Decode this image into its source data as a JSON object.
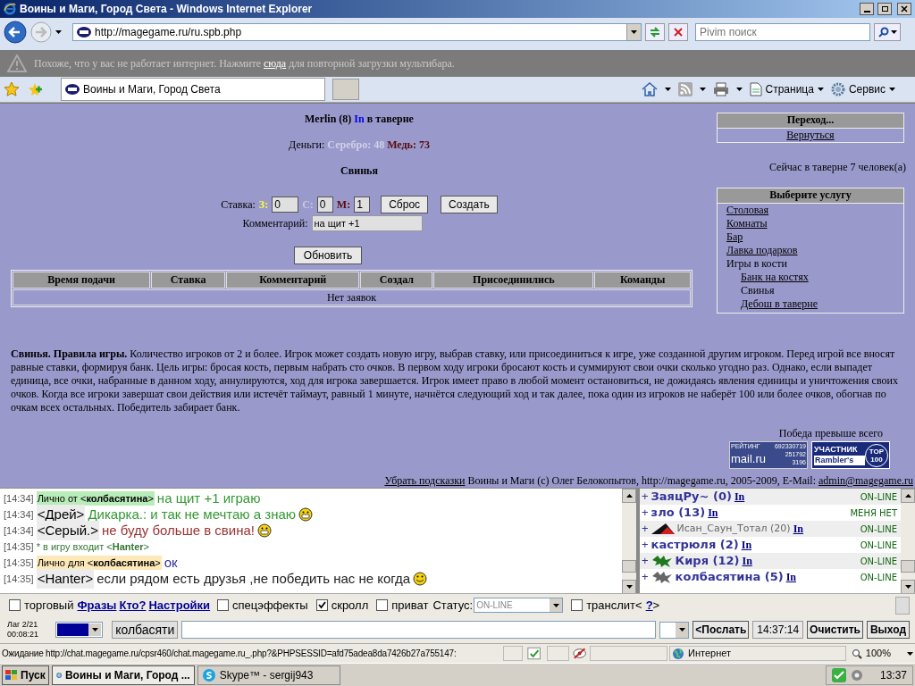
{
  "window": {
    "title": "Воины и Маги, Город Света - Windows Internet Explorer"
  },
  "address_bar": {
    "url": "http://magegame.ru/ru.spb.php",
    "search_placeholder": "Pivim поиск"
  },
  "infobar": {
    "before": "Похоже, что у вас не работает интернет. Нажмите",
    "link": "сюда",
    "after": "для повторной загрузки мультибара."
  },
  "tabs": [
    {
      "label": "Воины и Маги, Город Света",
      "selected": true
    }
  ],
  "command_bar": [
    "Страница",
    "Сервис"
  ],
  "game": {
    "player": "Merlin (8)",
    "player_link": "In",
    "location": "в таверне",
    "money": {
      "label": "Деньги:",
      "silver": "Серебро: 48",
      "copper": "Медь: 73"
    },
    "title": "Свинья",
    "bet": {
      "label": "Ставка:",
      "gold_label": "З:",
      "gold": "0",
      "silver_label": "С:",
      "silver": "0",
      "copper_label": "М:",
      "copper": "1"
    },
    "reset_button": "Сброс",
    "create_button": "Создать",
    "comment_label": "Комментарий:",
    "comment": "на щит +1",
    "refresh_button": "Обновить",
    "table": {
      "columns": [
        "Время подачи",
        "Ставка",
        "Комментарий",
        "Создал",
        "Присоединились",
        "Команды"
      ],
      "empty": "Нет заявок"
    },
    "rules": "**Свинья. Правила игры.** Количество игроков от 2 и более. Игрок может создать новую игру, выбрав ставку, или присоединиться к игре, уже созданной другим игроком. Перед игрой все вносят равные ставки, формируя банк. Цель игры: бросая кость, первым набрать сто очков. В первом ходу игроки бросают кость и суммируют свои очки сколько угодно раз. Однако, если выпадет единица, все очки, набранные в данном ходу, аннулируются, ход для игрока завершается. Игрок имеет право в любой момент остановиться, не дожидаясь явления единицы и уничтожения своих очков. Когда все игроки завершат свои действия или истечёт таймаут, равный 1 минуте, начнётся следующий ход и так далее, пока один из игроков не наберёт 100 или более очков, обогнав по очкам всех остальных. Победитель забирает банк.",
    "motto": "Победа превыше всего",
    "mail_counter": {
      "label": "РЕЙТИНГ",
      "total": "692330719",
      "brand": "mail.ru",
      "hits": "251792",
      "hosts": "3196"
    },
    "rambler_counter": {
      "label": "УЧАСТНИК",
      "brand": "Rambler's",
      "top": "TOP",
      "rank": "100"
    },
    "footer": {
      "link": "Убрать подсказки",
      "text": "Воины и Маги (c) Олег Белокопытов, http://magegame.ru, 2005-2009, E-Mail:",
      "email": "admin@magegame.ru"
    }
  },
  "sidebar": {
    "nav_title": "Переход...",
    "nav_link": "Вернуться",
    "visitors": "Сейчас в таверне 7 человек(а)",
    "services_title": "Выберите услугу",
    "services": [
      {
        "label": "Столовая",
        "kind": "link"
      },
      {
        "label": "Комнаты",
        "kind": "link"
      },
      {
        "label": "Бар",
        "kind": "link"
      },
      {
        "label": "Лавка подарков",
        "kind": "link"
      },
      {
        "label": "Игры в кости",
        "kind": "text",
        "children": [
          {
            "label": "Банк на костях",
            "kind": "link"
          },
          {
            "label": "Свинья",
            "kind": "text"
          },
          {
            "label": "Дебош в таверне",
            "kind": "link"
          }
        ]
      }
    ]
  },
  "chat": {
    "messages": [
      {
        "time": "[14:34]",
        "kind": "private_from",
        "nick": "Лично от <**колбасятина**>",
        "text": "на щит +1 играю",
        "color": "#339933"
      },
      {
        "time": "[14:34]",
        "kind": "say",
        "nick": "<Дрей>",
        "text": "Дикарка.: и так не мечтаю а знаю",
        "color": "#339933"
      },
      {
        "time": "[14:34]",
        "kind": "say",
        "nick": "<Серый.>",
        "text": "не буду больше в свина!",
        "color": "#993333"
      },
      {
        "time": "[14:35]",
        "kind": "system",
        "text": "* в игру входит <**Hanter**>",
        "color": "#337733"
      },
      {
        "time": "[14:35]",
        "kind": "private_to",
        "nick": "Лично для <**колбасятина**>",
        "text": "ок",
        "color": "#333399"
      },
      {
        "time": "[14:35]",
        "kind": "say",
        "nick": "<Hanter>",
        "text": "если рядом есть друзья ,не победить нас не когда",
        "color": "#222222"
      }
    ],
    "users": [
      {
        "toggle": "+",
        "name": "ЗаяцРу~",
        "level": "(0)",
        "link": "In",
        "status": "ON-LINE",
        "kind": "bold"
      },
      {
        "toggle": "+",
        "name": "зло",
        "level": "(13)",
        "link": "In",
        "status": "МЕНЯ НЕТ",
        "kind": "bold"
      },
      {
        "toggle": "+",
        "name": "Исан_Саун_Тотал",
        "level": "(20)",
        "link": "In",
        "status": "ON-LINE",
        "kind": "plain"
      },
      {
        "toggle": "+",
        "name": "кастрюля",
        "level": "(2)",
        "link": "In",
        "status": "ON-LINE",
        "kind": "bold"
      },
      {
        "toggle": "+",
        "name": "Киря",
        "level": "(12)",
        "link": "In",
        "status": "ON-LINE",
        "kind": "bold"
      },
      {
        "toggle": "+",
        "name": "колбасятина",
        "level": "(5)",
        "link": "In",
        "status": "ON-LINE",
        "kind": "bold"
      }
    ],
    "controls": [
      {
        "kind": "checkbox",
        "label": "торговый",
        "checked": false
      },
      {
        "kind": "link",
        "label": "Фразы"
      },
      {
        "kind": "link",
        "label": "Кто?"
      },
      {
        "kind": "link",
        "label": "Настройки"
      },
      {
        "kind": "checkbox",
        "label": "спецэффекты",
        "checked": false
      },
      {
        "kind": "checkbox",
        "label": "скролл",
        "checked": true
      },
      {
        "kind": "checkbox",
        "label": "приват",
        "checked": false
      },
      {
        "kind": "select",
        "label": "Статус:",
        "value": "ON-LINE"
      },
      {
        "kind": "checkbox",
        "label": "транслит<",
        "checked": false
      },
      {
        "kind": "link",
        "label": "?"
      },
      {
        "kind": "text",
        "label": ">"
      }
    ],
    "lag": "Лаг 2/21",
    "elapsed": "00:08:21",
    "recipient": "колбасяти",
    "send_button": "<Послать",
    "clock": "14:37:14",
    "clear_button": "Очистить",
    "exit_button": "Выход"
  },
  "status_bar": {
    "text": "Ожидание http://chat.magegame.ru/cpsr460/chat.magegame.ru_.php?&PHPSESSID=afd75adea8da7426b27a755147:",
    "zone": "Интернет",
    "zoom": "100%"
  },
  "taskbar": {
    "start": "Пуск",
    "tasks": [
      {
        "label": "Воины и Маги, Город ...",
        "selected": true
      },
      {
        "label": "Skype™ - sergij943",
        "selected": false
      }
    ],
    "clock": "13:37"
  }
}
